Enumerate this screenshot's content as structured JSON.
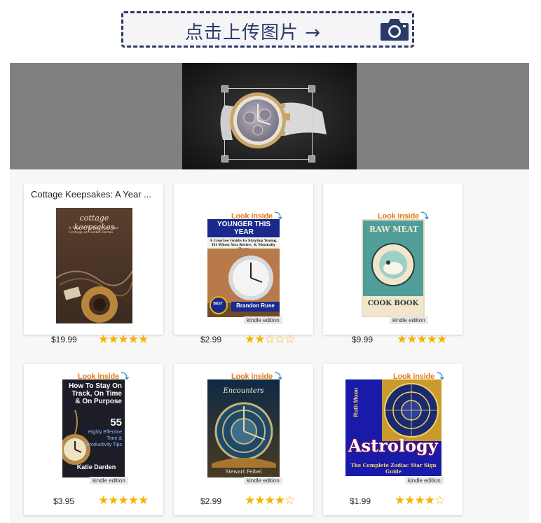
{
  "upload": {
    "label": "点击上传图片 →",
    "icon": "camera-icon"
  },
  "products": [
    {
      "title": "Cottage Keepsakes: A Year ...",
      "price": "$19.99",
      "rating": 5,
      "look_inside": "",
      "kindle": "",
      "cover_title": "cottage keepsakes",
      "cover_sub": "A Year of Pin Pals From The Cottage at Cardiff Farms"
    },
    {
      "title": "",
      "price": "$2.99",
      "rating": 2,
      "look_inside": "Look inside",
      "kindle": "kindle edition",
      "cover_title": "YOUNGER THIS YEAR",
      "cover_sub": "A Concise Guide to Staying Young, Fit When You Retire, & Mentally Sharp",
      "cover_author": "Brandon Ruse",
      "cover_badge": "BEST"
    },
    {
      "title": "",
      "price": "$9.99",
      "rating": 5,
      "look_inside": "Look inside",
      "kindle": "kindle edition",
      "cover_title": "RAW MEAT",
      "cover_sub": "COOK BOOK"
    },
    {
      "title": "",
      "price": "$3.95",
      "rating": 5,
      "look_inside": "Look inside",
      "kindle": "kindle edition",
      "cover_title": "How To Stay On Track, On Time & On Purpose",
      "cover_number": "55",
      "cover_sub": "Highly Effective Time & Productivity Tips",
      "cover_author": "Katie Darden"
    },
    {
      "title": "",
      "price": "$2.99",
      "rating": 4,
      "look_inside": "Look inside",
      "kindle": "kindle edition",
      "cover_title": "Encounters",
      "cover_author": "Stewart Feibel"
    },
    {
      "title": "",
      "price": "$1.99",
      "rating": 4,
      "look_inside": "Look inside",
      "kindle": "kindle edition",
      "cover_author": "Ruth Moon",
      "cover_title": "Astrology",
      "cover_sub": "The Complete Zodiac Star Sign Guide"
    }
  ],
  "colors": {
    "accent": "#2b3a67",
    "star": "#f5b400",
    "look_inside_orange": "#e47911",
    "look_inside_blue": "#1f8ec8"
  }
}
